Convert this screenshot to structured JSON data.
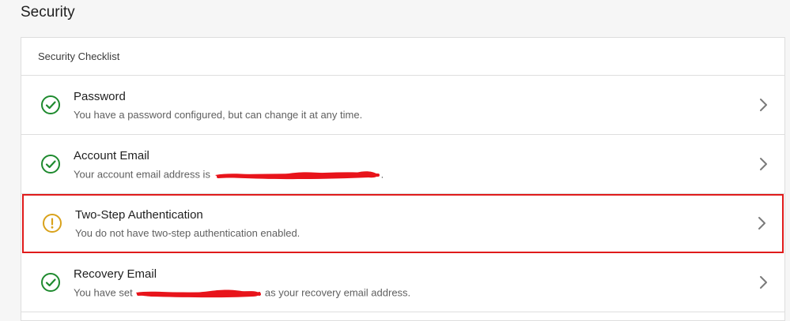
{
  "page": {
    "title": "Security"
  },
  "checklist": {
    "header": "Security Checklist",
    "items": [
      {
        "title": "Password",
        "description": "You have a password configured, but can change it at any time.",
        "status": "ok",
        "icon": "check-circle-icon"
      },
      {
        "title": "Account Email",
        "description_prefix": "Your account email address is ",
        "description_suffix": ".",
        "status": "ok",
        "icon": "check-circle-icon"
      },
      {
        "title": "Two-Step Authentication",
        "description": "You do not have two-step authentication enabled.",
        "status": "warning",
        "icon": "warning-circle-icon"
      },
      {
        "title": "Recovery Email",
        "description_prefix": "You have set ",
        "description_suffix": " as your recovery email address.",
        "status": "ok",
        "icon": "check-circle-icon"
      }
    ]
  },
  "colors": {
    "ok": "#1e8a2e",
    "warning": "#d9a21b",
    "highlight_border": "#e01b1b",
    "redaction": "#e8141b"
  }
}
